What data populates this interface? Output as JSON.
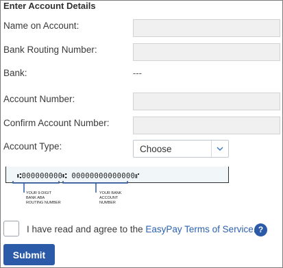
{
  "section": {
    "heading": "Enter Account Details"
  },
  "form": {
    "name_label": "Name on Account:",
    "routing_label": "Bank Routing Number:",
    "bank_label": "Bank:",
    "bank_value": "---",
    "account_label": "Account Number:",
    "confirm_label": "Confirm Account Number:",
    "type_label": "Account Type:",
    "type_selected": "Choose",
    "name_value": "",
    "routing_value": "",
    "account_value": "",
    "confirm_value": ""
  },
  "check_image": {
    "routing_digits": "⑆000000000⑆",
    "account_digits": "00000000000000⑈",
    "routing_caption_1": "YOUR 9-DIGIT",
    "routing_caption_2": "BANK ABA",
    "routing_caption_3": "ROUTING NUMBER",
    "account_caption_1": "YOUR BANK",
    "account_caption_2": "ACCOUNT",
    "account_caption_3": "NUMBER"
  },
  "agreement": {
    "text": "I have read and agree to the ",
    "link": "EasyPay Terms of Service",
    "suffix": ".",
    "help_icon": "question-mark-icon"
  },
  "actions": {
    "submit_label": "Submit"
  },
  "colors": {
    "accent": "#2b5aa8",
    "link": "#2b61b0",
    "field_bg": "#f0f0f0"
  }
}
